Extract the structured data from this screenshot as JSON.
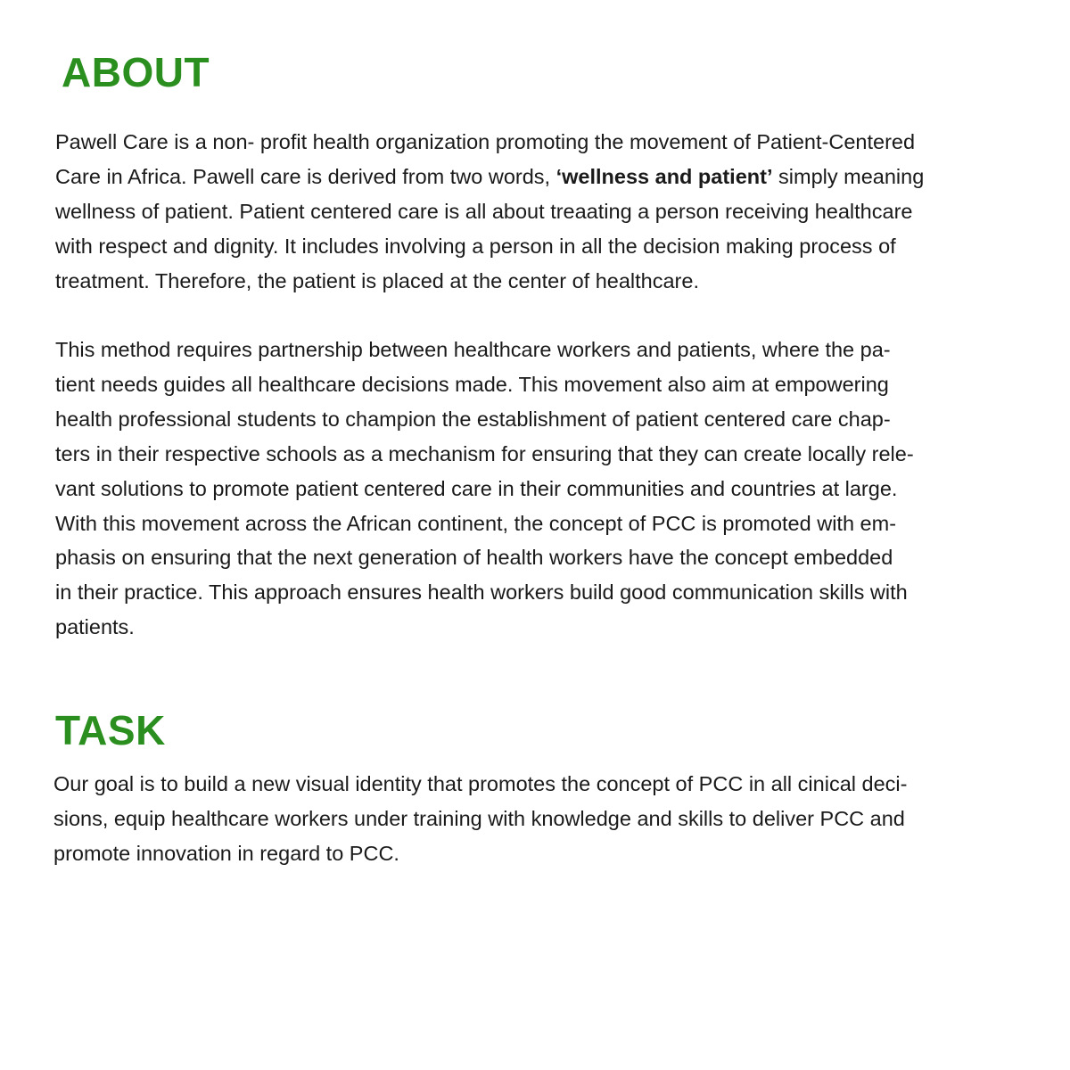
{
  "about": {
    "heading": "ABOUT",
    "paragraph1": {
      "line1": "Pawell Care is a non- profit health organization promoting the movement of Patient-Centered",
      "line2_before": "Care in Africa. Pawell care is derived from two words, ",
      "line2_emphasis": "‘wellness and patient’",
      "line2_after": " simply meaning",
      "line3": "wellness of patient. Patient centered care is all about treaating a person receiving healthcare",
      "line4": "with respect and dignity. It includes involving a person in all the decision making process of",
      "line5": "treatment. Therefore, the patient is placed at the center of healthcare."
    },
    "paragraph2": {
      "lines": [
        "This method requires partnership between healthcare workers and patients, where the pa-",
        "tient needs guides all healthcare decisions made. This movement also aim at empowering",
        "health professional students to champion the establishment of patient centered care chap-",
        "ters in their respective schools as a mechanism for ensuring that they can create locally rele-",
        "vant solutions to promote patient centered care in their communities and countries at large.",
        "With this movement across the African continent, the concept of PCC is promoted with em-",
        "phasis on ensuring that the next generation of health workers have the concept embedded",
        "in their practice. This approach ensures health workers build good communication skills with",
        "patients."
      ]
    }
  },
  "task": {
    "heading": "TASK",
    "paragraph": {
      "lines": [
        "Our goal is to build a new visual identity that promotes the concept of PCC in all cinical deci-",
        "sions, equip healthcare workers under training with knowledge and skills to deliver PCC and",
        "promote innovation in regard to PCC."
      ]
    }
  },
  "colors": {
    "heading": "#2a8f1f",
    "body_text": "#1a1a1a",
    "background": "#ffffff"
  }
}
